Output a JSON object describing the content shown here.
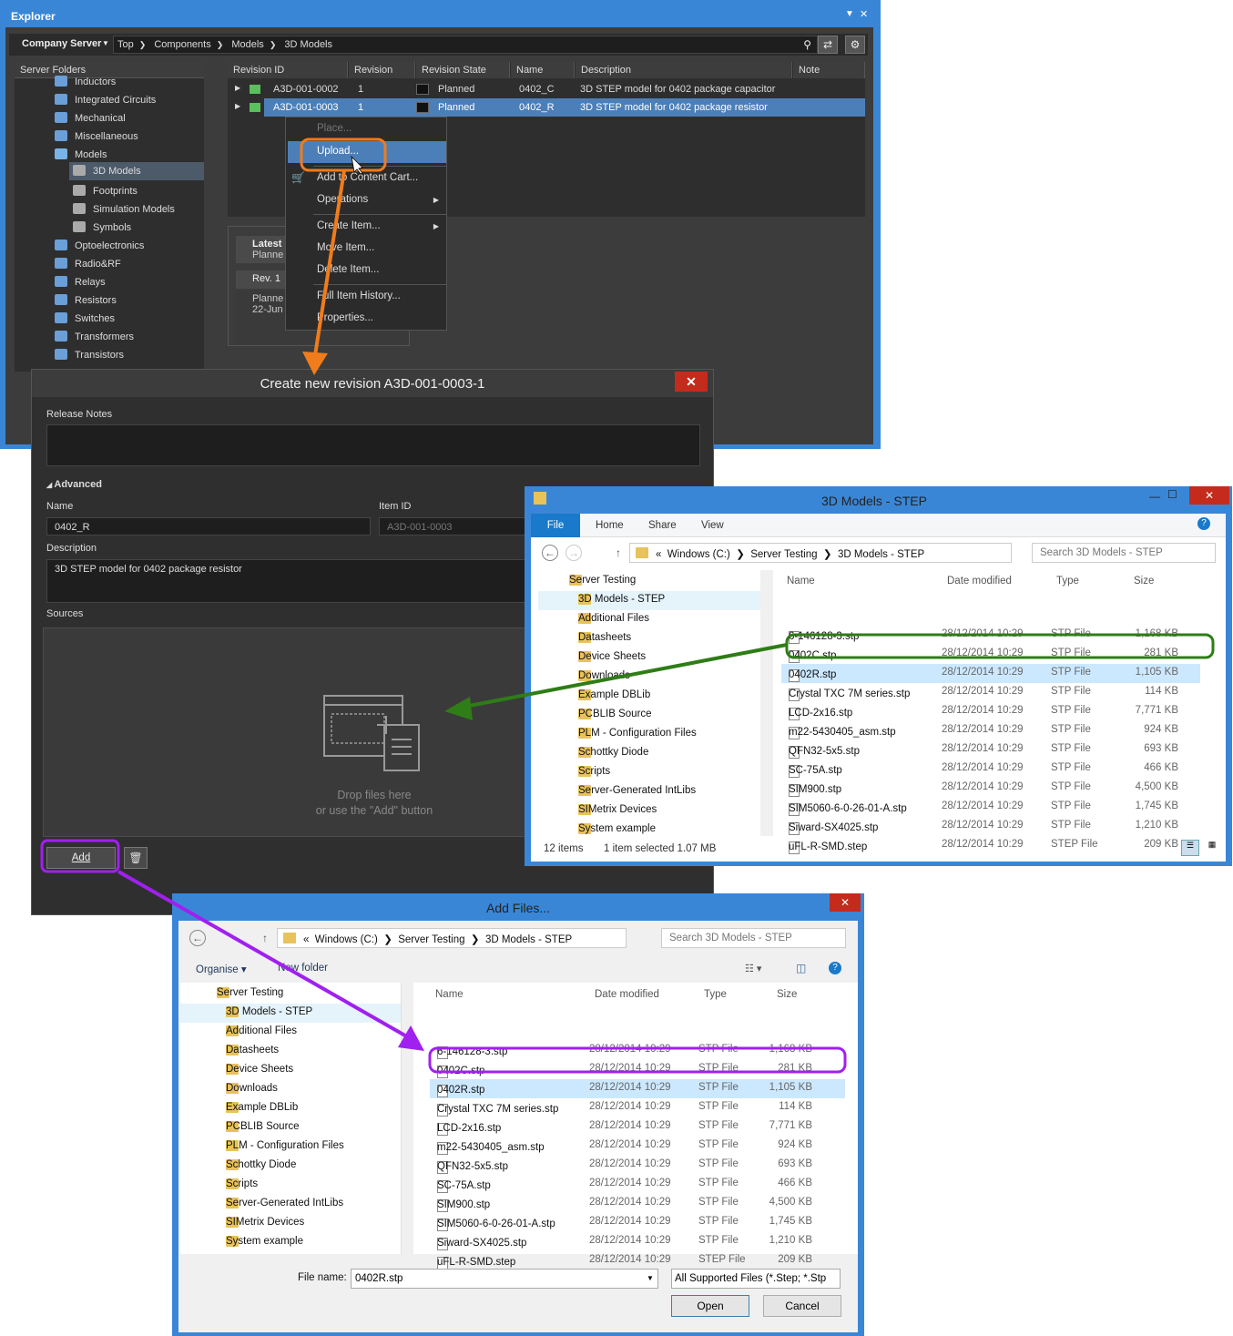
{
  "explorer": {
    "title": "Explorer",
    "server": "Company Server",
    "breadcrumb": [
      "Top",
      "Components",
      "Models",
      "3D Models"
    ],
    "folders_header": "Server Folders",
    "folders": [
      {
        "label": "Inductors"
      },
      {
        "label": "Integrated Circuits"
      },
      {
        "label": "Mechanical"
      },
      {
        "label": "Miscellaneous"
      },
      {
        "label": "Models"
      },
      {
        "label": "3D Models"
      },
      {
        "label": "Footprints"
      },
      {
        "label": "Simulation Models"
      },
      {
        "label": "Symbols"
      },
      {
        "label": "Optoelectronics"
      },
      {
        "label": "Radio&RF"
      },
      {
        "label": "Relays"
      },
      {
        "label": "Resistors"
      },
      {
        "label": "Switches"
      },
      {
        "label": "Transformers"
      },
      {
        "label": "Transistors"
      }
    ],
    "columns": [
      "Revision ID",
      "Revision",
      "Revision State",
      "Name",
      "Description",
      "Note"
    ],
    "rows": [
      {
        "id": "A3D-001-0002",
        "rev": "1",
        "state": "Planned",
        "name": "0402_C",
        "desc": "3D STEP model for 0402 package capacitor"
      },
      {
        "id": "A3D-001-0003",
        "rev": "1",
        "state": "Planned",
        "name": "0402_R",
        "desc": "3D STEP model for 0402 package resistor"
      }
    ],
    "context_menu": [
      "Place...",
      "Upload...",
      "Add to Content Cart...",
      "Operations",
      "Create Item...",
      "Move Item...",
      "Delete Item...",
      "Full Item History...",
      "Properties..."
    ],
    "side_panel": {
      "latest": "Latest",
      "planned1": "Planne",
      "rev": "Rev. 1",
      "planned2": "Planne",
      "date": "22-Jun"
    }
  },
  "create_dialog": {
    "title": "Create new revision A3D-001-0003-1",
    "release_notes_label": "Release Notes",
    "advanced_label": "Advanced",
    "name_label": "Name",
    "name_value": "0402_R",
    "item_id_label": "Item ID",
    "item_id_value": "A3D-001-0003",
    "description_label": "Description",
    "description_value": "3D STEP model for 0402 package resistor",
    "sources_label": "Sources",
    "drop_text_1": "Drop files here",
    "drop_text_2": "or use the \"Add\" button",
    "add_button": "Add"
  },
  "file_explorer": {
    "title": "3D Models - STEP",
    "ribbon": [
      "File",
      "Home",
      "Share",
      "View"
    ],
    "address": [
      "Windows (C:)",
      "Server Testing",
      "3D Models - STEP"
    ],
    "search_placeholder": "Search 3D Models - STEP",
    "nav": [
      "Server Testing",
      "3D Models - STEP",
      "Additional Files",
      "Datasheets",
      "Device Sheets",
      "Downloads",
      "Example DBLib",
      "PCBLIB Source",
      "PLM - Configuration Files",
      "Schottky Diode",
      "Scripts",
      "Server-Generated IntLibs",
      "SIMetrix Devices",
      "System example"
    ],
    "columns": [
      "Name",
      "Date modified",
      "Type",
      "Size"
    ],
    "files": [
      {
        "name": "6-146128-3.stp",
        "date": "28/12/2014 10:29",
        "type": "STP File",
        "size": "1,168 KB"
      },
      {
        "name": "0402C.stp",
        "date": "28/12/2014 10:29",
        "type": "STP File",
        "size": "281 KB"
      },
      {
        "name": "0402R.stp",
        "date": "28/12/2014 10:29",
        "type": "STP File",
        "size": "1,105 KB"
      },
      {
        "name": "Crystal TXC 7M series.stp",
        "date": "28/12/2014 10:29",
        "type": "STP File",
        "size": "114 KB"
      },
      {
        "name": "LCD-2x16.stp",
        "date": "28/12/2014 10:29",
        "type": "STP File",
        "size": "7,771 KB"
      },
      {
        "name": "m22-5430405_asm.stp",
        "date": "28/12/2014 10:29",
        "type": "STP File",
        "size": "924 KB"
      },
      {
        "name": "QFN32-5x5.stp",
        "date": "28/12/2014 10:29",
        "type": "STP File",
        "size": "693 KB"
      },
      {
        "name": "SC-75A.stp",
        "date": "28/12/2014 10:29",
        "type": "STP File",
        "size": "466 KB"
      },
      {
        "name": "SIM900.stp",
        "date": "28/12/2014 10:29",
        "type": "STP File",
        "size": "4,500 KB"
      },
      {
        "name": "SIM5060-6-0-26-01-A.stp",
        "date": "28/12/2014 10:29",
        "type": "STP File",
        "size": "1,745 KB"
      },
      {
        "name": "Siward-SX4025.stp",
        "date": "28/12/2014 10:29",
        "type": "STP File",
        "size": "1,210 KB"
      },
      {
        "name": "uFL-R-SMD.step",
        "date": "28/12/2014 10:29",
        "type": "STEP File",
        "size": "209 KB"
      }
    ],
    "status_items": "12 items",
    "status_selected": "1 item selected  1.07 MB"
  },
  "add_files": {
    "title": "Add Files...",
    "organise": "Organise",
    "new_folder": "New folder",
    "file_name_label": "File name:",
    "file_name_value": "0402R.stp",
    "filter": "All Supported Files (*.Step; *.Stp",
    "open": "Open",
    "cancel": "Cancel"
  },
  "colors": {
    "accent": "#3a86d6",
    "highlight_orange": "#f07c1c",
    "highlight_green": "#2e7d16",
    "highlight_purple": "#a020f0"
  }
}
